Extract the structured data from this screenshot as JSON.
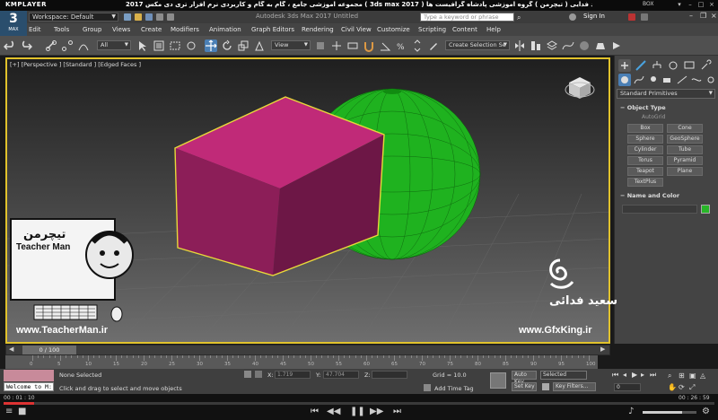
{
  "player": {
    "brand": "KMPLAYER",
    "caption": "مجموعه آموزشی جامع ، گام به گام و کاربردی نرم افزار تری دی مکس 2017  ( 3ds max 2017 )   مدرس : سعید فدایی ( تیچرمن ) گروه آموزشی پادشاه گرافیست ها",
    "box_label": "BOX",
    "time_current": "00 : 01 : 10",
    "time_total": "00 : 26 : 59",
    "progress_fraction": 0.043
  },
  "titlebar": {
    "logo_big": "3",
    "logo_small": "MAX",
    "workspace": "Workspace: Default",
    "app_title": "Autodesk 3ds Max 2017   Untitled",
    "search_placeholder": "Type a keyword or phrase",
    "signin": "Sign In"
  },
  "menu": [
    "Edit",
    "Tools",
    "Group",
    "Views",
    "Create",
    "Modifiers",
    "Animation",
    "Graph Editors",
    "Rendering",
    "Civil View",
    "Customize",
    "Scripting",
    "Content",
    "Help"
  ],
  "toolbar": {
    "filter_dropdown": "All",
    "refcoord_dropdown": "View",
    "selset_dropdown": "Create Selection Se"
  },
  "viewport": {
    "label": "[+] [Perspective ] [Standard ] [Edged Faces ]",
    "selected_box_color": "#c02a78",
    "sphere_color": "#1fb21f",
    "highlight_color": "#e8d83a"
  },
  "command_panel": {
    "category": "Standard Primitives",
    "object_type_title": "Object Type",
    "autogrid": "AutoGrid",
    "buttons": [
      "Box",
      "Cone",
      "Sphere",
      "GeoSphere",
      "Cylinder",
      "Tube",
      "Torus",
      "Pyramid",
      "Teapot",
      "Plane",
      "TextPlus"
    ],
    "name_color_title": "Name and Color",
    "object_color": "#28b628"
  },
  "timeline": {
    "slider": "0 / 100",
    "ticks": [
      "0",
      "5",
      "10",
      "15",
      "20",
      "25",
      "30",
      "35",
      "40",
      "45",
      "50",
      "55",
      "60",
      "65",
      "70",
      "75",
      "80",
      "85",
      "90",
      "95",
      "100"
    ]
  },
  "status": {
    "selection": "None Selected",
    "prompt": "Click and drag to select and move objects",
    "welcome": "Welcome to M:",
    "x_label": "X:",
    "x_value": "1.719",
    "y_label": "Y:",
    "y_value": "47.704",
    "z_label": "Z:",
    "grid": "Grid = 10.0",
    "add_time_tag": "Add Time Tag",
    "auto_key": "Auto Key",
    "selected": "Selected",
    "set_key": "Set Key",
    "key_filters": "Key Filters...",
    "frame": "0"
  },
  "watermarks": {
    "teacher_site": "www.TeacherMan.ir",
    "teacher_name": "Teacher Man",
    "teacher_logo_fa": "تیچرمن",
    "gfx_site": "www.GfxKing.ir",
    "gfx_name_fa": "سعید فدائی"
  }
}
